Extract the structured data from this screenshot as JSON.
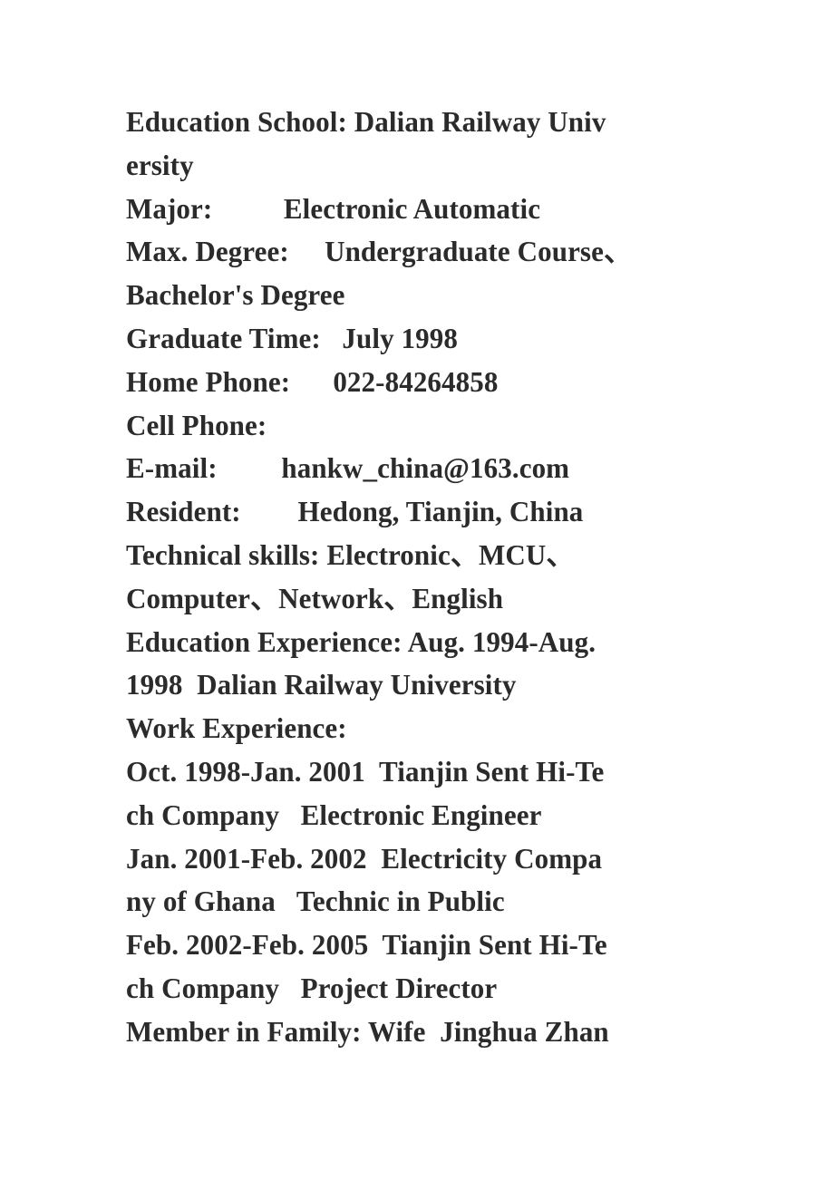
{
  "document": {
    "type": "resume",
    "background_color": "#ffffff",
    "text_color": "#2b2b2b",
    "lines": [
      "Education School: Dalian Railway Univ",
      "ersity",
      "Major:          Electronic Automatic",
      "Max. Degree:     Undergraduate Course、",
      "Bachelor's Degree",
      "Graduate Time:   July 1998",
      "Home Phone:      022-84264858",
      "Cell Phone:",
      "E-mail:         hankw_china@163.com",
      "Resident:        Hedong, Tianjin, China",
      "Technical skills: Electronic、MCU、",
      "Computer、Network、English",
      "Education Experience: Aug. 1994-Aug.",
      "1998  Dalian Railway University",
      "Work Experience:",
      "Oct. 1998-Jan. 2001  Tianjin Sent Hi-Te",
      "ch Company   Electronic Engineer",
      "Jan. 2001-Feb. 2002  Electricity Compa",
      "ny of Ghana   Technic in Public",
      "Feb. 2002-Feb. 2005  Tianjin Sent Hi-Te",
      "ch Company   Project Director",
      "Member in Family: Wife  Jinghua Zhan"
    ],
    "fields": {
      "education_school_label": "Education School:",
      "education_school_value": "Dalian Railway University",
      "major_label": "Major:",
      "major_value": "Electronic Automatic",
      "max_degree_label": "Max. Degree:",
      "max_degree_value": "Undergraduate Course、Bachelor's Degree",
      "graduate_time_label": "Graduate Time:",
      "graduate_time_value": "July 1998",
      "home_phone_label": "Home Phone:",
      "home_phone_value": "022-84264858",
      "cell_phone_label": "Cell Phone:",
      "cell_phone_value": "",
      "email_label": "E-mail:",
      "email_value": "hankw_china@163.com",
      "resident_label": "Resident:",
      "resident_value": "Hedong, Tianjin, China",
      "technical_skills_label": "Technical skills:",
      "technical_skills_value": "Electronic、MCU、Computer、Network、English",
      "education_experience_label": "Education Experience:",
      "education_experience_value": "Aug. 1994-Aug. 1998  Dalian Railway University",
      "work_experience_label": "Work Experience:",
      "member_in_family_label": "Member in Family:",
      "member_in_family_value": "Wife  Jinghua Zhan"
    },
    "work_experience": [
      {
        "period": "Oct. 1998-Jan. 2001",
        "company": "Tianjin Sent Hi-Tech Company",
        "title": "Electronic Engineer"
      },
      {
        "period": "Jan. 2001-Feb. 2002",
        "company": "Electricity Company of Ghana",
        "title": "Technic in Public"
      },
      {
        "period": "Feb. 2002-Feb. 2005",
        "company": "Tianjin Sent Hi-Tech Company",
        "title": "Project Director"
      }
    ]
  }
}
